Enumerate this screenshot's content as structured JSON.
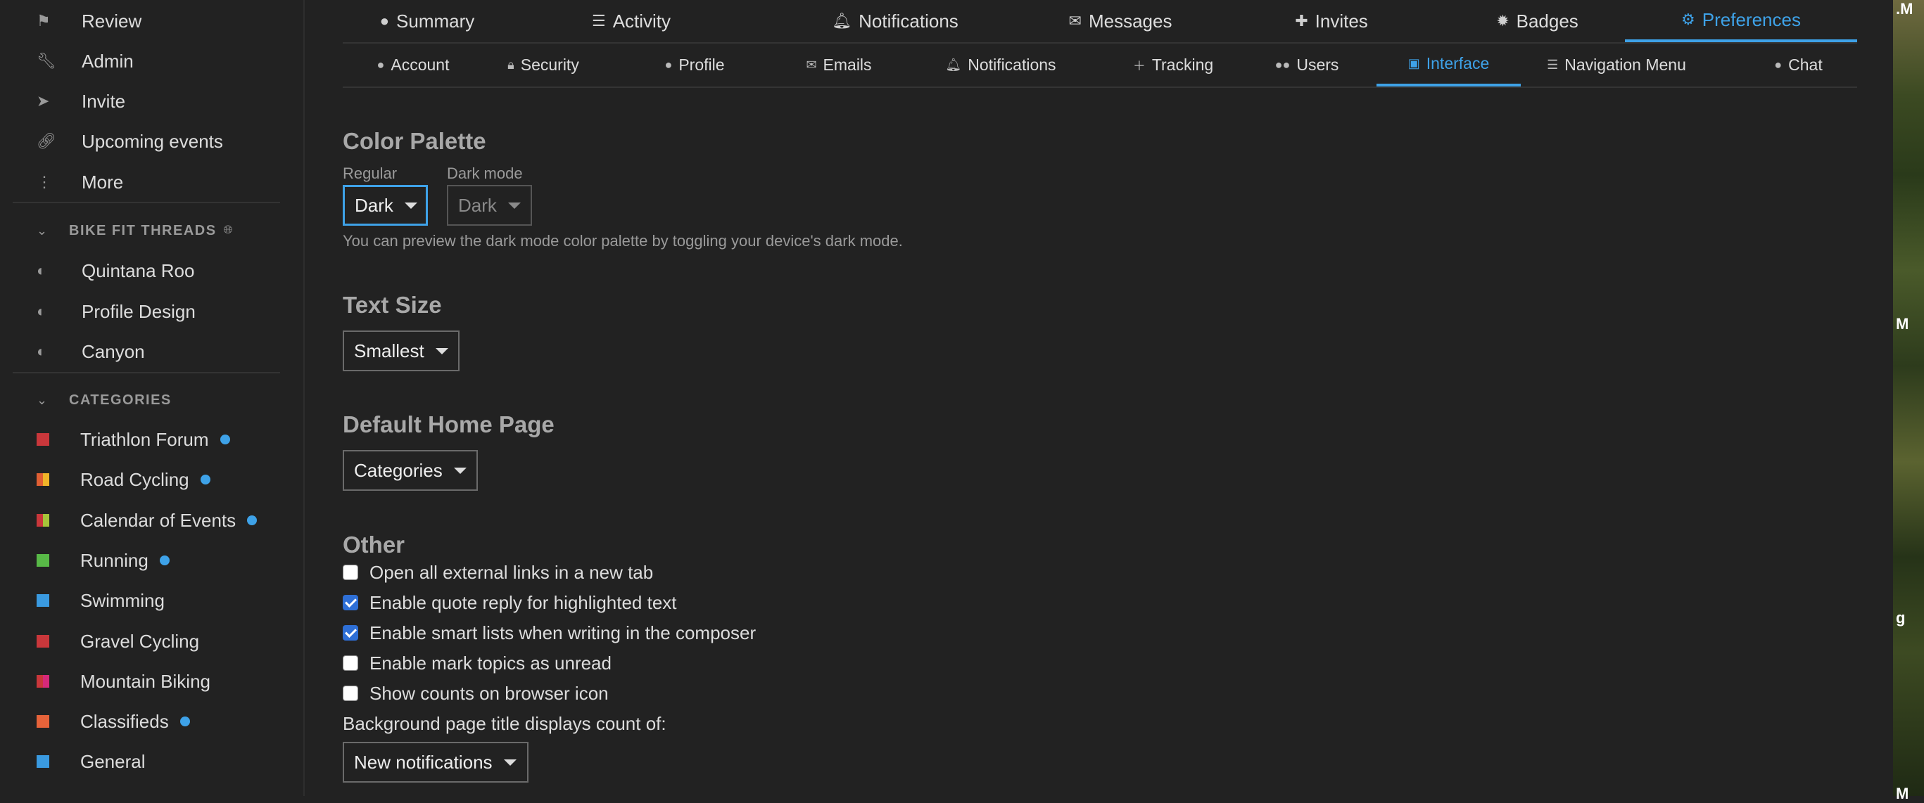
{
  "sidebar": {
    "nav": [
      {
        "label": "Review",
        "icon": "flag-icon"
      },
      {
        "label": "Admin",
        "icon": "wrench-icon"
      },
      {
        "label": "Invite",
        "icon": "paper-plane-icon"
      },
      {
        "label": "Upcoming events",
        "icon": "link-icon"
      },
      {
        "label": "More",
        "icon": "vertical-dots-icon"
      }
    ],
    "bike_section": {
      "title": "BIKE FIT THREADS",
      "items": [
        {
          "label": "Quintana Roo"
        },
        {
          "label": "Profile Design"
        },
        {
          "label": "Canyon"
        }
      ]
    },
    "categories_section": {
      "title": "CATEGORIES",
      "items": [
        {
          "label": "Triathlon Forum",
          "colors": [
            "#c9373b"
          ],
          "new": true
        },
        {
          "label": "Road Cycling",
          "colors": [
            "#e05f33",
            "#f0b429"
          ],
          "new": true
        },
        {
          "label": "Calendar of Events",
          "colors": [
            "#c9373b",
            "#a6c43a"
          ],
          "new": true
        },
        {
          "label": "Running",
          "colors": [
            "#58b947"
          ],
          "new": true
        },
        {
          "label": "Swimming",
          "colors": [
            "#3a9ae0"
          ],
          "new": false
        },
        {
          "label": "Gravel Cycling",
          "colors": [
            "#c9373b"
          ],
          "new": false
        },
        {
          "label": "Mountain Biking",
          "colors": [
            "#c9373b",
            "#d6297a"
          ],
          "new": false
        },
        {
          "label": "Classifieds",
          "colors": [
            "#e6633a"
          ],
          "new": true
        },
        {
          "label": "General",
          "colors": [
            "#3a9ae0"
          ],
          "new": false
        }
      ]
    }
  },
  "user_tabs": [
    {
      "label": "Summary",
      "icon": "user-icon",
      "active": false
    },
    {
      "label": "Activity",
      "icon": "list-icon",
      "active": false
    },
    {
      "label": "Notifications",
      "icon": "bell-icon",
      "active": false
    },
    {
      "label": "Messages",
      "icon": "envelope-icon",
      "active": false
    },
    {
      "label": "Invites",
      "icon": "user-plus-icon",
      "active": false
    },
    {
      "label": "Badges",
      "icon": "badge-icon",
      "active": false
    },
    {
      "label": "Preferences",
      "icon": "gear-icon",
      "active": true
    }
  ],
  "pref_tabs": [
    {
      "label": "Account",
      "icon": "user-icon",
      "active": false
    },
    {
      "label": "Security",
      "icon": "lock-icon",
      "active": false
    },
    {
      "label": "Profile",
      "icon": "user-icon",
      "active": false
    },
    {
      "label": "Emails",
      "icon": "envelope-icon",
      "active": false
    },
    {
      "label": "Notifications",
      "icon": "bell-icon",
      "active": false
    },
    {
      "label": "Tracking",
      "icon": "plus-icon",
      "active": false
    },
    {
      "label": "Users",
      "icon": "users-icon",
      "active": false
    },
    {
      "label": "Interface",
      "icon": "desktop-icon",
      "active": true
    },
    {
      "label": "Navigation Menu",
      "icon": "bars-icon",
      "active": false
    },
    {
      "label": "Chat",
      "icon": "comment-icon",
      "active": false
    }
  ],
  "color_palette": {
    "title": "Color Palette",
    "regular_label": "Regular",
    "regular_value": "Dark",
    "dark_label": "Dark mode",
    "dark_value": "Dark",
    "hint": "You can preview the dark mode color palette by toggling your device's dark mode."
  },
  "text_size": {
    "title": "Text Size",
    "value": "Smallest"
  },
  "home_page": {
    "title": "Default Home Page",
    "value": "Categories"
  },
  "other": {
    "title": "Other",
    "checkboxes": [
      {
        "label": "Open all external links in a new tab",
        "checked": false
      },
      {
        "label": "Enable quote reply for highlighted text",
        "checked": true
      },
      {
        "label": "Enable smart lists when writing in the composer",
        "checked": true
      },
      {
        "label": "Enable mark topics as unread",
        "checked": false
      },
      {
        "label": "Show counts on browser icon",
        "checked": false
      }
    ],
    "title_count_label": "Background page title displays count of:",
    "title_count_value": "New notifications"
  },
  "photo_fragments": [
    ".M",
    "M",
    "g",
    "M"
  ],
  "colors": {
    "accent": "#3ea2e8",
    "background": "#222222"
  }
}
